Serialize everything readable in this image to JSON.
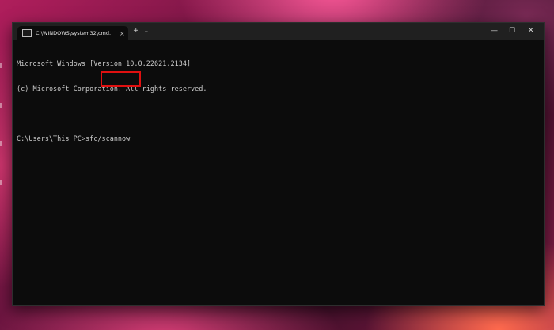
{
  "window": {
    "tab_title": "C:\\WINDOWS\\system32\\cmd.",
    "tab_close": "×",
    "new_tab": "+",
    "tab_dropdown": "⌄",
    "minimize": "—",
    "maximize": "☐",
    "close": "✕"
  },
  "console": {
    "lines": [
      "Microsoft Windows [Version 10.0.22621.2134]",
      "(c) Microsoft Corporation. All rights reserved.",
      "",
      "C:\\Users\\This PC>sfc/scannow"
    ]
  },
  "icons": {
    "terminal": "terminal-icon",
    "close_tab": "close-icon",
    "new_tab": "plus-icon",
    "dropdown": "chevron-down-icon"
  },
  "colors": {
    "console_bg": "#0c0c0c",
    "titlebar_bg": "#202020",
    "console_text": "#cccccc",
    "highlight_box": "#e01010"
  }
}
